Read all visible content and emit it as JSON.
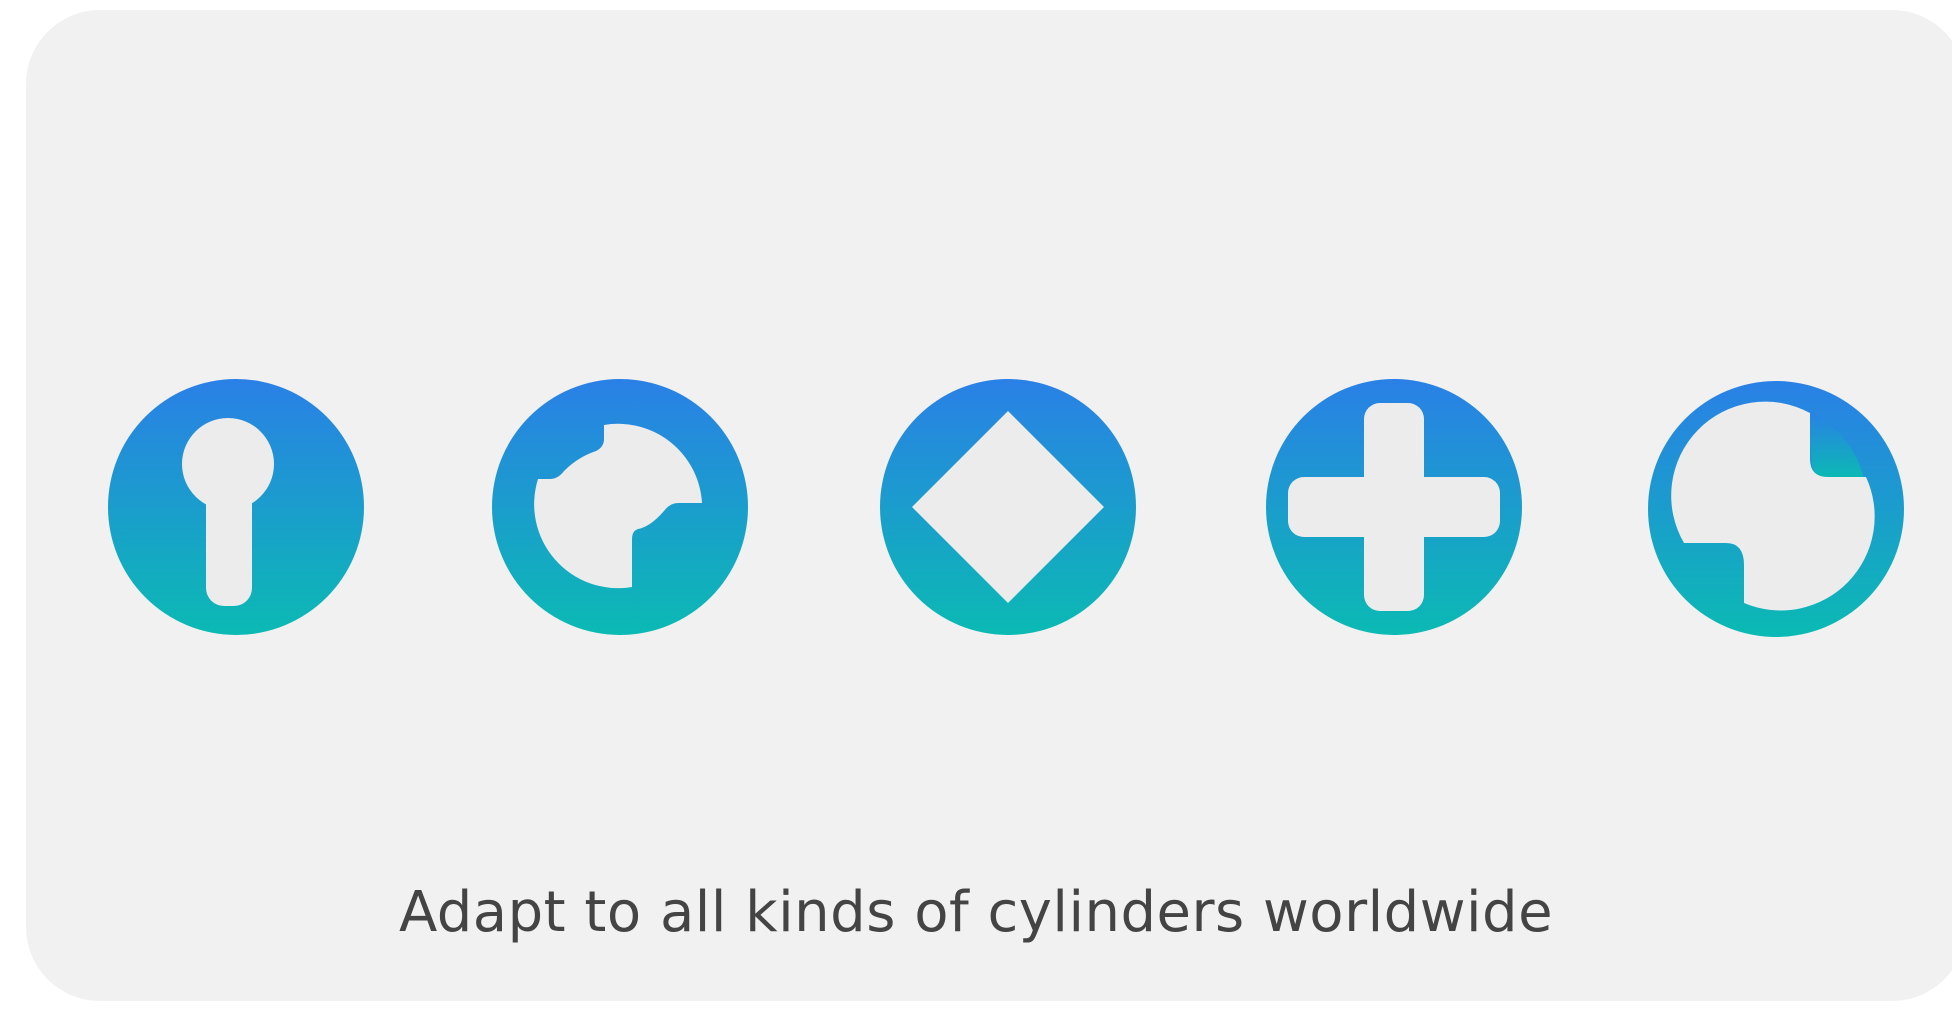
{
  "caption": "Adapt to all kinds of cylinders worldwide",
  "colors": {
    "background": "#f1f1f1",
    "gradient_top": "#2a80e6",
    "gradient_bottom": "#0bbab3",
    "keyhole_fill": "#ececec",
    "caption_text": "#444444"
  },
  "icons": [
    {
      "name": "euro-profile-cylinder-icon"
    },
    {
      "name": "round-notched-cylinder-icon"
    },
    {
      "name": "diamond-cylinder-icon"
    },
    {
      "name": "cross-cylinder-icon"
    },
    {
      "name": "offset-notched-cylinder-icon"
    }
  ]
}
